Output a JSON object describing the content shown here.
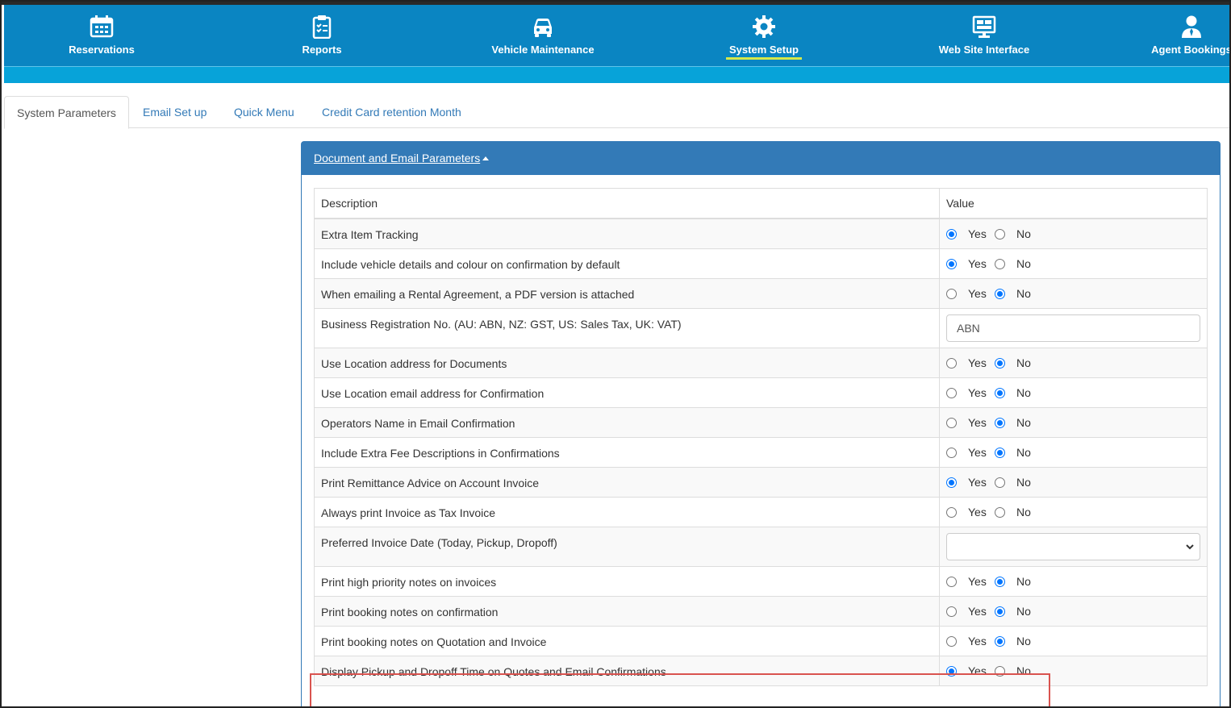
{
  "nav": [
    {
      "label": "Reservations",
      "icon": "calendar-icon",
      "active": false
    },
    {
      "label": "Reports",
      "icon": "clipboard-icon",
      "active": false
    },
    {
      "label": "Vehicle Maintenance",
      "icon": "car-icon",
      "active": false
    },
    {
      "label": "System Setup",
      "icon": "gear-icon",
      "active": true
    },
    {
      "label": "Web Site Interface",
      "icon": "monitor-icon",
      "active": false
    },
    {
      "label": "Agent Bookings",
      "icon": "user-icon",
      "active": false
    }
  ],
  "tabs": [
    {
      "label": "System Parameters",
      "active": true
    },
    {
      "label": "Email Set up",
      "active": false
    },
    {
      "label": "Quick Menu",
      "active": false
    },
    {
      "label": "Credit Card retention Month",
      "active": false
    }
  ],
  "panel": {
    "title": "Document and Email Parameters",
    "col_description": "Description",
    "col_value": "Value",
    "yes_label": "Yes",
    "no_label": "No",
    "rows": [
      {
        "description": "Extra Item Tracking",
        "type": "radio",
        "value": "Yes"
      },
      {
        "description": "Include vehicle details and colour on confirmation by default",
        "type": "radio",
        "value": "Yes"
      },
      {
        "description": "When emailing a Rental Agreement, a PDF version is attached",
        "type": "radio",
        "value": "No"
      },
      {
        "description": "Business Registration No. (AU: ABN, NZ: GST, US: Sales Tax, UK: VAT)",
        "type": "text",
        "value": "ABN"
      },
      {
        "description": "Use Location address for Documents",
        "type": "radio",
        "value": "No"
      },
      {
        "description": "Use Location email address for Confirmation",
        "type": "radio",
        "value": "No"
      },
      {
        "description": "Operators Name in Email Confirmation",
        "type": "radio",
        "value": "No"
      },
      {
        "description": "Include Extra Fee Descriptions in Confirmations",
        "type": "radio",
        "value": "No"
      },
      {
        "description": "Print Remittance Advice on Account Invoice",
        "type": "radio",
        "value": "Yes"
      },
      {
        "description": "Always print Invoice as Tax Invoice",
        "type": "radio",
        "value": ""
      },
      {
        "description": "Preferred Invoice Date (Today, Pickup, Dropoff)",
        "type": "select",
        "value": ""
      },
      {
        "description": "Print high priority notes on invoices",
        "type": "radio",
        "value": "No"
      },
      {
        "description": "Print booking notes on confirmation",
        "type": "radio",
        "value": "No"
      },
      {
        "description": "Print booking notes on Quotation and Invoice",
        "type": "radio",
        "value": "No"
      },
      {
        "description": "Display Pickup and Dropoff Time on Quotes and Email Confirmations",
        "type": "radio",
        "value": "Yes",
        "highlighted": true
      }
    ]
  },
  "colors": {
    "nav_bg": "#0a85c2",
    "subbar_bg": "#07a3d9",
    "panel_head": "#337ab7",
    "highlight_border": "#d9534f",
    "active_underline": "#d6e84a"
  }
}
